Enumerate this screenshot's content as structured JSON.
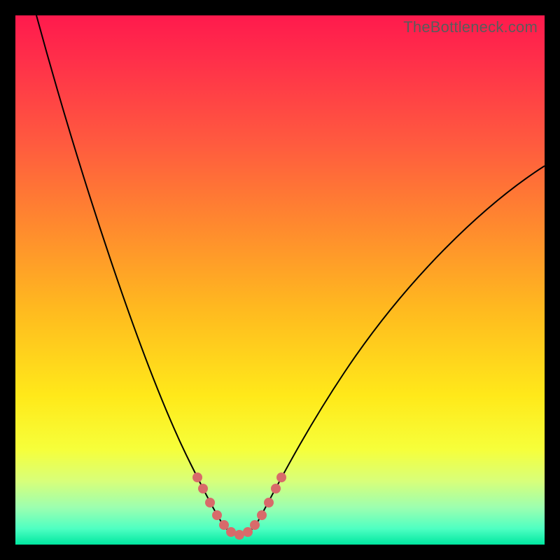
{
  "watermark": "TheBottleneck.com",
  "colors": {
    "gradient_top": "#ff1a4d",
    "gradient_mid": "#ffe91a",
    "gradient_bottom": "#00e7a0",
    "curve": "#000000",
    "dots": "#d86a6a",
    "frame": "#000000"
  },
  "chart_data": {
    "type": "line",
    "title": "",
    "xlabel": "",
    "ylabel": "",
    "xlim": [
      0,
      100
    ],
    "ylim": [
      0,
      100
    ],
    "grid": false,
    "legend": false,
    "series": [
      {
        "name": "left-branch",
        "x": [
          4,
          8,
          12,
          16,
          20,
          24,
          28,
          30,
          32,
          33.5,
          35,
          36.5,
          38
        ],
        "y": [
          100,
          86,
          72,
          58,
          45,
          33,
          22,
          16,
          11,
          8,
          5.5,
          3.5,
          2
        ]
      },
      {
        "name": "bottom-flat",
        "x": [
          38,
          39.5,
          41,
          42.5,
          44
        ],
        "y": [
          2,
          1.6,
          1.5,
          1.6,
          2
        ]
      },
      {
        "name": "right-branch",
        "x": [
          44,
          46,
          48,
          52,
          58,
          66,
          76,
          88,
          100
        ],
        "y": [
          2,
          4,
          7,
          13,
          22,
          33,
          45,
          58,
          70
        ]
      }
    ],
    "annotations": {
      "highlight_dots_x": [
        33.5,
        35,
        36.5,
        38,
        39.5,
        41,
        42.5,
        44,
        45.5,
        47,
        48.5
      ],
      "highlight_dots_y": [
        8,
        5.5,
        3.5,
        2,
        1.6,
        1.5,
        1.6,
        2,
        3.5,
        5.5,
        8
      ]
    }
  }
}
